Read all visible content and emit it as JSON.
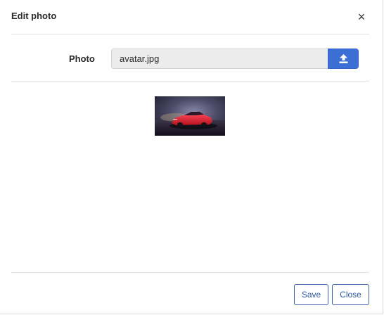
{
  "dialog": {
    "title": "Edit photo",
    "close_glyph": "×"
  },
  "form": {
    "photo_label": "Photo",
    "file_value": "avatar.jpg",
    "upload_icon": "upload-icon"
  },
  "preview": {
    "alt": "preview image of red sports car"
  },
  "footer": {
    "save_label": "Save",
    "close_label": "Close"
  },
  "colors": {
    "accent": "#3b6fd6",
    "button_border": "#3b5fa8",
    "input_bg": "#ececec"
  }
}
